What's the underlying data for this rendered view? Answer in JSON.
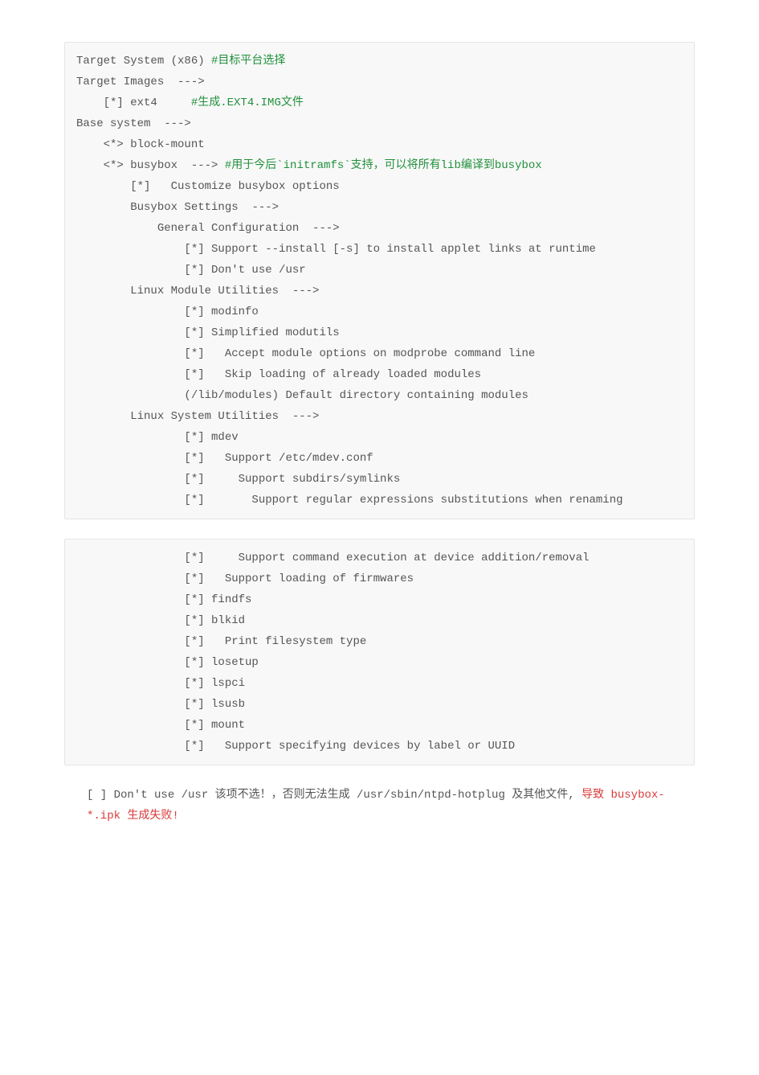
{
  "doc": {
    "block1": {
      "l01_a": "Target System (x86) ",
      "l01_b": "#目标平台选择",
      "l02": "Target Images  --->",
      "l03_a": "    [*] ext4     ",
      "l03_b": "#生成.EXT4.IMG文件",
      "l04": "Base system  --->",
      "l05": "    <*> block-mount",
      "l06_a": "    <*> busybox  ---> ",
      "l06_b": "#用于今后`initramfs`支持，可以将所有lib编译到busybox",
      "l07": "        [*]   Customize busybox options",
      "l08": "        Busybox Settings  --->",
      "l09": "            General Configuration  --->",
      "l10": "                [*] Support --install [-s] to install applet links at runtime",
      "l11": "                [*] Don't use /usr",
      "l12": "        Linux Module Utilities  --->",
      "l13": "                [*] modinfo",
      "l14": "                [*] Simplified modutils",
      "l15": "                [*]   Accept module options on modprobe command line",
      "l16": "                [*]   Skip loading of already loaded modules",
      "l17": "                (/lib/modules) Default directory containing modules",
      "l18": "        Linux System Utilities  --->",
      "l19": "                [*] mdev",
      "l20": "                [*]   Support /etc/mdev.conf",
      "l21": "                [*]     Support subdirs/symlinks",
      "l22": "                [*]       Support regular expressions substitutions when renaming"
    },
    "block2": {
      "l01": "                [*]     Support command execution at device addition/removal",
      "l02": "                [*]   Support loading of firmwares",
      "l03": "                [*] findfs",
      "l04": "                [*] blkid",
      "l05": "                [*]   Print filesystem type",
      "l06": "                [*] losetup",
      "l07": "                [*] lspci",
      "l08": "                [*] lsusb",
      "l09": "                [*] mount",
      "l10": "                [*]   Support specifying devices by label or UUID"
    },
    "note": {
      "line1_a": "[ ] Don't use /usr  该项不选！，否则无法生成 /usr/sbin/ntpd-hotplug 及其他文件, ",
      "line1_b": "导致 busybox-*.ipk 生成失败!"
    }
  }
}
